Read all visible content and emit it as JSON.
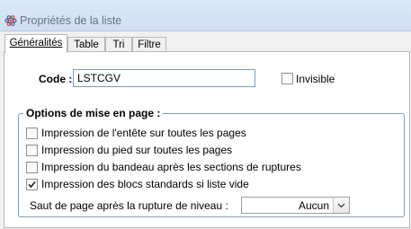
{
  "window": {
    "title": "Propriétés de la liste"
  },
  "tabs": [
    {
      "label": "Généralités",
      "active": true
    },
    {
      "label": "Table",
      "active": false
    },
    {
      "label": "Tri",
      "active": false
    },
    {
      "label": "Filtre",
      "active": false
    }
  ],
  "code": {
    "label": "Code :",
    "value": "LSTCGV"
  },
  "invisible": {
    "label": "Invisible",
    "checked": false
  },
  "group": {
    "title": "Options de mise en page :",
    "options": [
      {
        "label": "Impression de l'entête sur toutes les pages",
        "checked": false
      },
      {
        "label": "Impression du pied sur toutes les pages",
        "checked": false
      },
      {
        "label": "Impression du bandeau après les sections de ruptures",
        "checked": false
      },
      {
        "label": "Impression des blocs standards si liste vide",
        "checked": true
      }
    ],
    "page_break": {
      "label": "Saut de page après la rupture de niveau :",
      "value": "Aucun"
    }
  }
}
